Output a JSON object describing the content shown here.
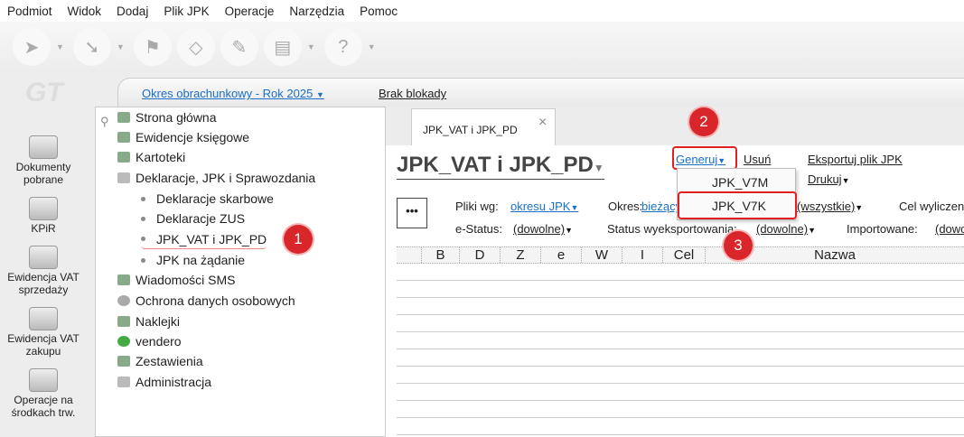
{
  "menu": [
    "Podmiot",
    "Widok",
    "Dodaj",
    "Plik JPK",
    "Operacje",
    "Narzędzia",
    "Pomoc"
  ],
  "toolbar_icons": [
    "back-arrow-icon",
    "forward-arrow-icon",
    "flag-icon",
    "document-icon",
    "edit-icon",
    "printer-icon",
    "help-icon"
  ],
  "logo": "GT",
  "left_nav": [
    "Dokumenty pobrane",
    "KPiR",
    "Ewidencja VAT sprzedaży",
    "Ewidencja VAT zakupu",
    "Operacje na środkach trw."
  ],
  "topbar": {
    "period": "Okres obrachunkowy - Rok 2025",
    "lock": "Brak blokady"
  },
  "tree": {
    "items": [
      "Strona główna",
      "Ewidencje księgowe",
      "Kartoteki",
      "Deklaracje, JPK i Sprawozdania",
      "Deklaracje skarbowe",
      "Deklaracje ZUS",
      "JPK_VAT i JPK_PD",
      "JPK na żądanie",
      "Wiadomości SMS",
      "Ochrona danych osobowych",
      "Naklejki",
      "vendero",
      "Zestawienia",
      "Administracja"
    ]
  },
  "tab": {
    "label": "JPK_VAT i JPK_PD",
    "close": "×"
  },
  "main": {
    "title": "JPK_VAT i JPK_PD",
    "actions": {
      "generate": "Generuj",
      "delete": "Usuń",
      "export": "Eksportuj plik JPK",
      "print": "Drukuj"
    },
    "more": "•••",
    "filters": {
      "files_by_label": "Pliki wg:",
      "files_by": "okresu JPK",
      "period_label": "Okres:",
      "period": "bieżący",
      "all": "(wszystkie)",
      "target_label": "Cel wyliczen",
      "estatus_label": "e-Status:",
      "estatus": "(dowolne)",
      "export_status_label": "Status wyeksportowania:",
      "export_status": "(dowolne)",
      "imported_label": "Importowane:",
      "imported": "(dowo"
    },
    "columns": [
      "",
      "B",
      "D",
      "Z",
      "e",
      "W",
      "I",
      "Cel",
      "Nazwa"
    ]
  },
  "dropdown": [
    "JPK_V7M",
    "JPK_V7K"
  ],
  "badges": [
    "1",
    "2",
    "3"
  ]
}
